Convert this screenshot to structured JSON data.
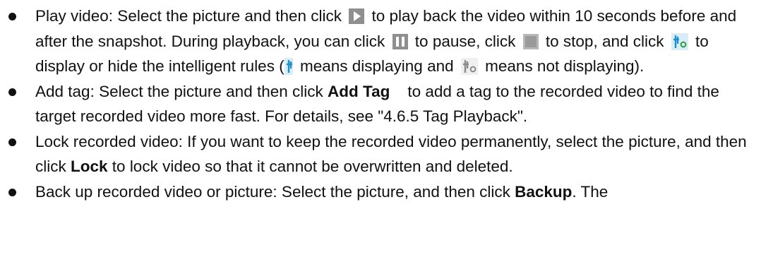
{
  "items": [
    {
      "p1": "Play video: Select the picture and then click",
      "p2": "to play back the video within 10 seconds before and after the snapshot. During playback, you can click",
      "p3": "to pause, click",
      "p4": "to stop, and click",
      "p5": "to display or hide the intelligent rules (",
      "p6": "means displaying and",
      "p7": "means not displaying)."
    },
    {
      "p1": "Add tag: Select the picture and then click",
      "bold": "Add Tag",
      "p2": "to add a tag to the recorded video to find the target recorded video more fast. For details, see \"4.6.5 Tag Playback\"."
    },
    {
      "p1": "Lock recorded video: If you want to keep the recorded video permanently, select the picture, and then click",
      "bold": "Lock",
      "p2": "to lock video so that it cannot be overwritten and deleted."
    },
    {
      "p1": "Back up recorded video or picture: Select the picture, and then click",
      "bold": "Backup",
      "p2": ". The"
    }
  ],
  "icons": {
    "play": "play-icon",
    "pause": "pause-icon",
    "stop": "stop-icon",
    "rules_on": "intelligent-rules-on-icon",
    "rules_off": "intelligent-rules-off-icon"
  },
  "colors": {
    "rules_on": "#1e90c8",
    "rules_accent": "#2f9e44",
    "rules_off": "#8a8a8a",
    "control_icon": "#8f8f8f"
  }
}
